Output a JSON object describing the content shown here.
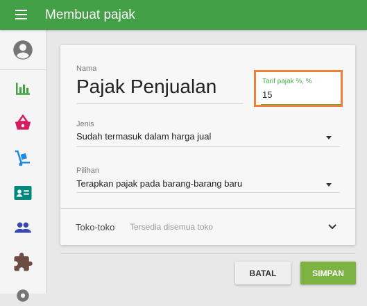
{
  "topbar": {
    "title": "Membuat pajak",
    "menu_icon": "hamburger-menu-icon"
  },
  "sidebar": {
    "avatar_icon": "account-circle-icon",
    "items": [
      {
        "icon": "bar-chart-icon",
        "color": "#43a047"
      },
      {
        "icon": "shopping-basket-icon",
        "color": "#d81b60"
      },
      {
        "icon": "hand-truck-icon",
        "color": "#1e88e5"
      },
      {
        "icon": "contact-card-icon",
        "color": "#00897b"
      },
      {
        "icon": "people-icon",
        "color": "#3949ab"
      },
      {
        "icon": "puzzle-piece-icon",
        "color": "#6d4c41"
      },
      {
        "icon": "settings-icon",
        "color": "#757575"
      }
    ]
  },
  "form": {
    "name_label": "Nama",
    "name_value": "Pajak Penjualan",
    "tarif_label": "Tarif pajak %, %",
    "tarif_value": "15",
    "jenis_label": "Jenis",
    "jenis_value": "Sudah termasuk dalam harga jual",
    "pilihan_label": "Pilihan",
    "pilihan_value": "Terapkan pajak pada barang-barang baru",
    "toko_label": "Toko-toko",
    "toko_value": "Tersedia disemua toko"
  },
  "actions": {
    "cancel_label": "BATAL",
    "save_label": "SIMPAN"
  },
  "colors": {
    "primary": "#43a047",
    "highlight": "#ee8133",
    "save_button": "#7cb342"
  }
}
